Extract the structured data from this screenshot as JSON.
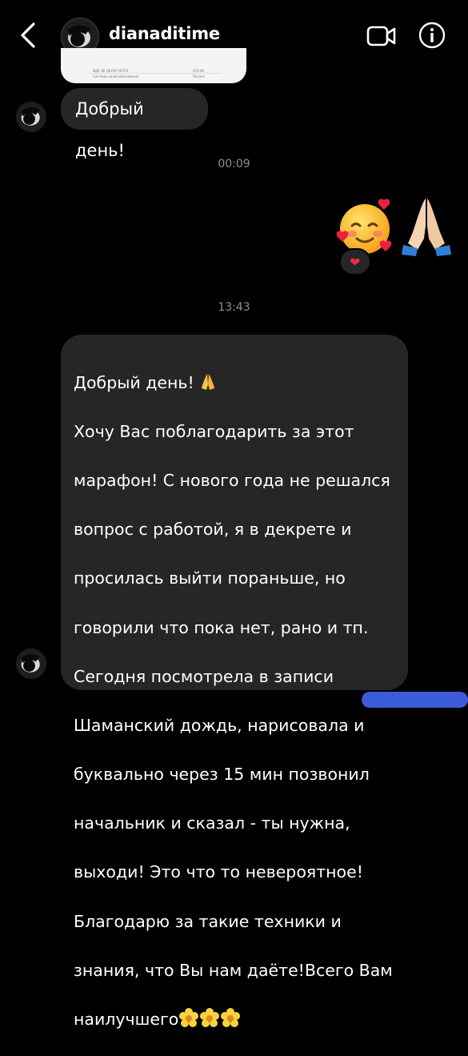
{
  "header": {
    "username": "dianaditime"
  },
  "previous_attachment": {
    "row1_left": "ИДЕ НЕ ОБЛАГАЕТСЯ",
    "row1_right": "€50.00",
    "row2_left": "Система налогообложения",
    "row2_right": "Патент"
  },
  "messages": [
    {
      "id": "m1",
      "direction": "incoming",
      "text": "Добрый день!"
    },
    {
      "id": "ts1",
      "type": "timestamp",
      "text": "00:09"
    },
    {
      "id": "m2",
      "direction": "outgoing",
      "emojis": [
        "smiling-face-with-hearts",
        "folded-hands"
      ],
      "reaction": "red-heart"
    },
    {
      "id": "ts2",
      "type": "timestamp",
      "text": "13:43"
    },
    {
      "id": "m3",
      "direction": "incoming",
      "lines": [
        "Добрый день!",
        "Хочу Вас поблагодарить за этот",
        "марафон! С нового года не решался",
        "вопрос с работой, я в декрете и",
        "просилась выйти пораньше, но",
        "говорили что пока нет, рано и тп.",
        "Сегодня посмотрела в записи",
        "Шаманский дождь, нарисовала и",
        "буквально через 15 мин позвонил",
        "начальник и сказал - ты нужна,",
        "выходи! Это что то невероятное!",
        "Благодарю за такие техники и",
        "знания, что Вы нам даёте!Всего Вам",
        "наилучшего"
      ],
      "trailing_emojis": [
        "blossom",
        "blossom",
        "blossom"
      ]
    }
  ],
  "colors": {
    "background": "#000000",
    "bubble_incoming": "#262626",
    "timestamp": "#8e8e8e",
    "reaction_heart": "#ed2a4a"
  }
}
